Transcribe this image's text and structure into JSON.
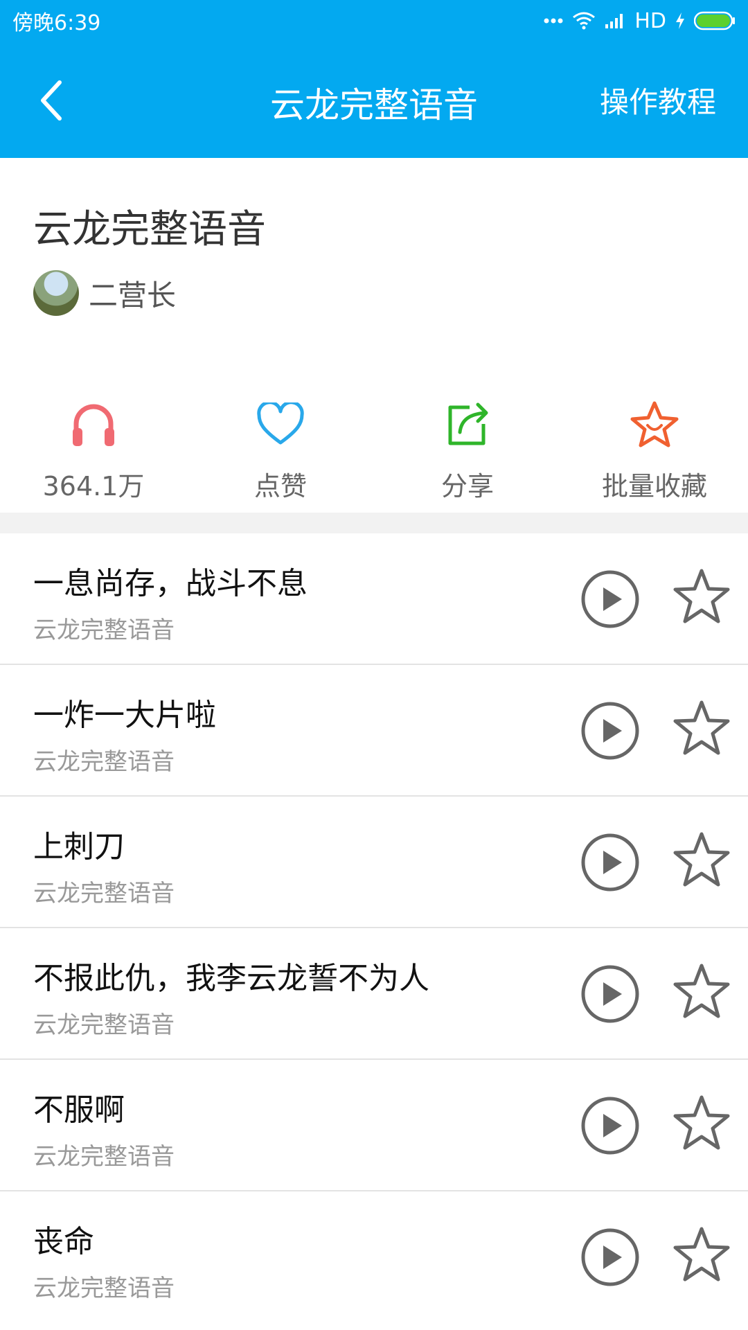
{
  "status_bar": {
    "time": "傍晚6:39",
    "network": "HD"
  },
  "top_bar": {
    "title": "云龙完整语音",
    "tutorial": "操作教程"
  },
  "header": {
    "title": "云龙完整语音",
    "author": "二营长"
  },
  "actions": [
    {
      "label": "364.1万",
      "icon": "headphones-icon",
      "color": "#f06a72"
    },
    {
      "label": "点赞",
      "icon": "heart-icon",
      "color": "#29a8ea"
    },
    {
      "label": "分享",
      "icon": "share-icon",
      "color": "#2fb52a"
    },
    {
      "label": "批量收藏",
      "icon": "star-smile-icon",
      "color": "#f06030"
    }
  ],
  "list": [
    {
      "title": "一息尚存，战斗不息",
      "subtitle": "云龙完整语音"
    },
    {
      "title": "一炸一大片啦",
      "subtitle": "云龙完整语音"
    },
    {
      "title": "上刺刀",
      "subtitle": "云龙完整语音"
    },
    {
      "title": "不报此仇，我李云龙誓不为人",
      "subtitle": "云龙完整语音"
    },
    {
      "title": "不服啊",
      "subtitle": "云龙完整语音"
    },
    {
      "title": "丧命",
      "subtitle": "云龙完整语音"
    }
  ],
  "colors": {
    "brand": "#03a9f0",
    "separator": "#f2f2f2",
    "icon_gray": "#666666"
  }
}
